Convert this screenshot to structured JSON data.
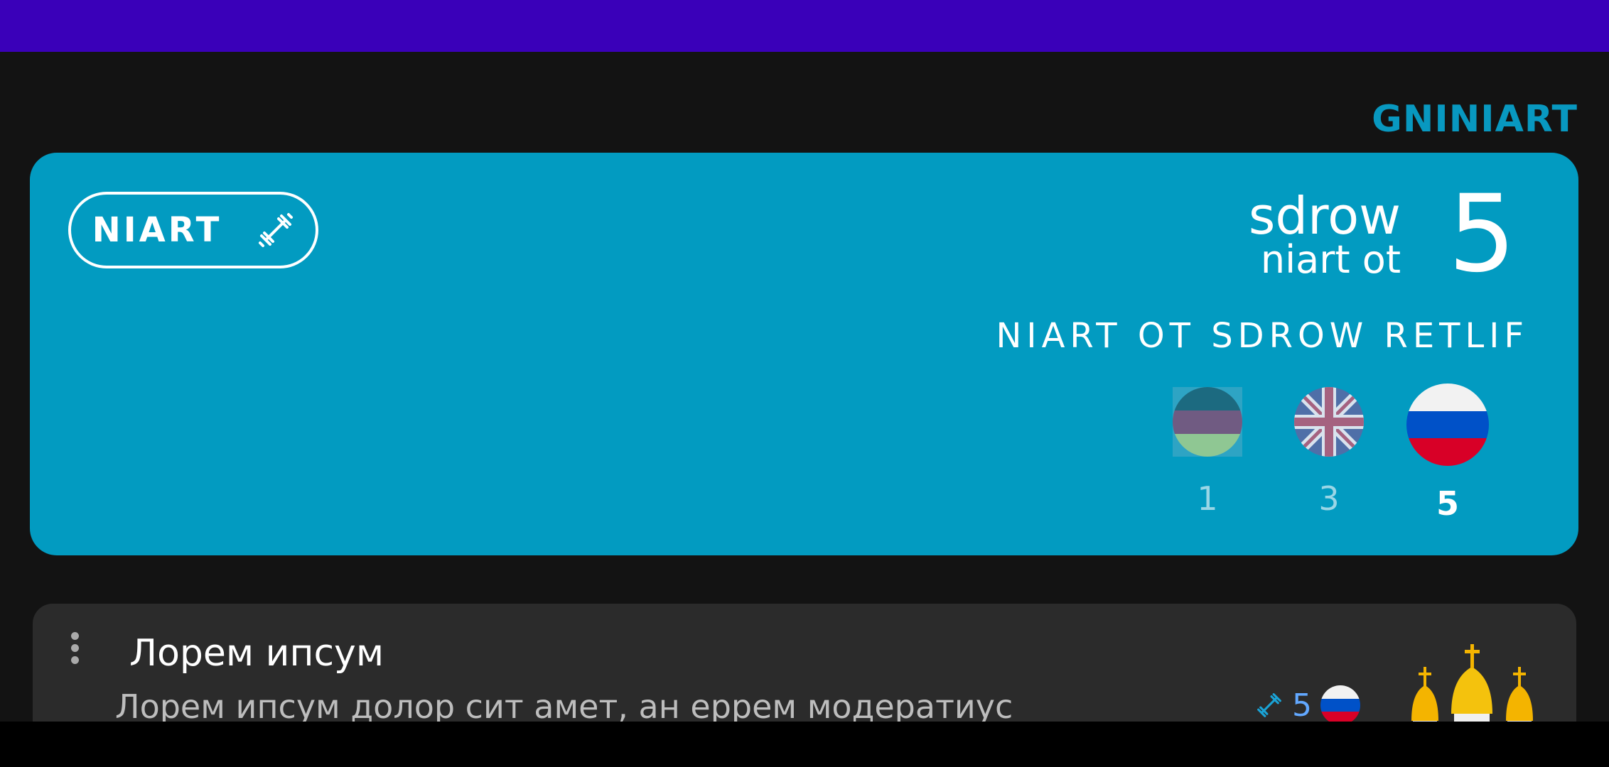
{
  "section": {
    "title": "GNINIART"
  },
  "train_card": {
    "button_label": "NIART",
    "words_line1": "sdrow",
    "words_line2": "niart ot",
    "words_count": "5",
    "filter_label": "NIART OT SDROW RETLIF",
    "flags": [
      {
        "icon": "bilingual-flag-icon",
        "count": "1",
        "active": false
      },
      {
        "icon": "uk-flag-icon",
        "count": "3",
        "active": false
      },
      {
        "icon": "russia-flag-icon",
        "count": "5",
        "active": true
      }
    ]
  },
  "lesson": {
    "title": "Лорем ипсум",
    "description": "Лорем ипсум долор сит амет, ан еррем модератиус",
    "count": "5"
  },
  "colors": {
    "status_bar": "#3a00b9",
    "card": "#029bc1",
    "accent": "#0898c0",
    "background": "#131313",
    "lesson_card": "#2b2b2b"
  }
}
